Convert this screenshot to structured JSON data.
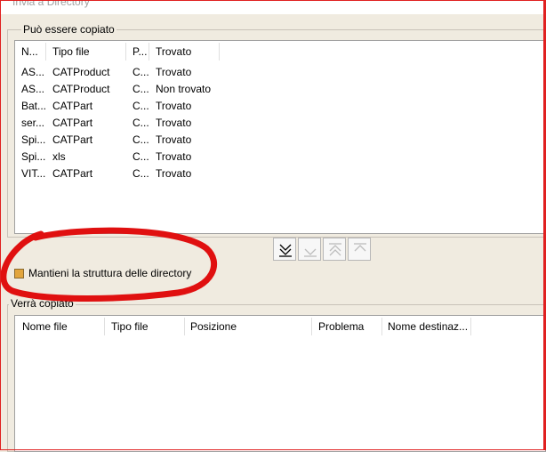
{
  "window": {
    "title": "Invia a Directory"
  },
  "top_group": {
    "label": "Può essere copiato",
    "columns": [
      "N...",
      "Tipo file",
      "P...",
      "Trovato"
    ],
    "rows": [
      [
        "AS...",
        "CATProduct",
        "C...",
        "Trovato"
      ],
      [
        "AS...",
        "CATProduct",
        "C...",
        "Non trovato"
      ],
      [
        "Bat...",
        "CATPart",
        "C...",
        "Trovato"
      ],
      [
        "ser...",
        "CATPart",
        "C...",
        "Trovato"
      ],
      [
        "Spi...",
        "CATPart",
        "C...",
        "Trovato"
      ],
      [
        "Spi...",
        "xls",
        "C...",
        "Trovato"
      ],
      [
        "VIT...",
        "CATPart",
        "C...",
        "Trovato"
      ]
    ]
  },
  "toolbar": {
    "buttons": [
      {
        "name": "move-all-down-icon",
        "enabled": true
      },
      {
        "name": "move-down-icon",
        "enabled": false
      },
      {
        "name": "move-all-up-icon",
        "enabled": false
      },
      {
        "name": "move-up-icon",
        "enabled": false
      }
    ]
  },
  "keep_structure": {
    "label": "Mantieni la struttura delle directory",
    "checked": true
  },
  "bottom_group": {
    "label": "Verrà copiato",
    "columns": [
      "Nome file",
      "Tipo file",
      "Posizione",
      "Problema",
      "Nome destinaz..."
    ]
  },
  "colors": {
    "annotation": "#e01010",
    "checkbox": "#e2a53d",
    "background": "#f0ebe0"
  }
}
